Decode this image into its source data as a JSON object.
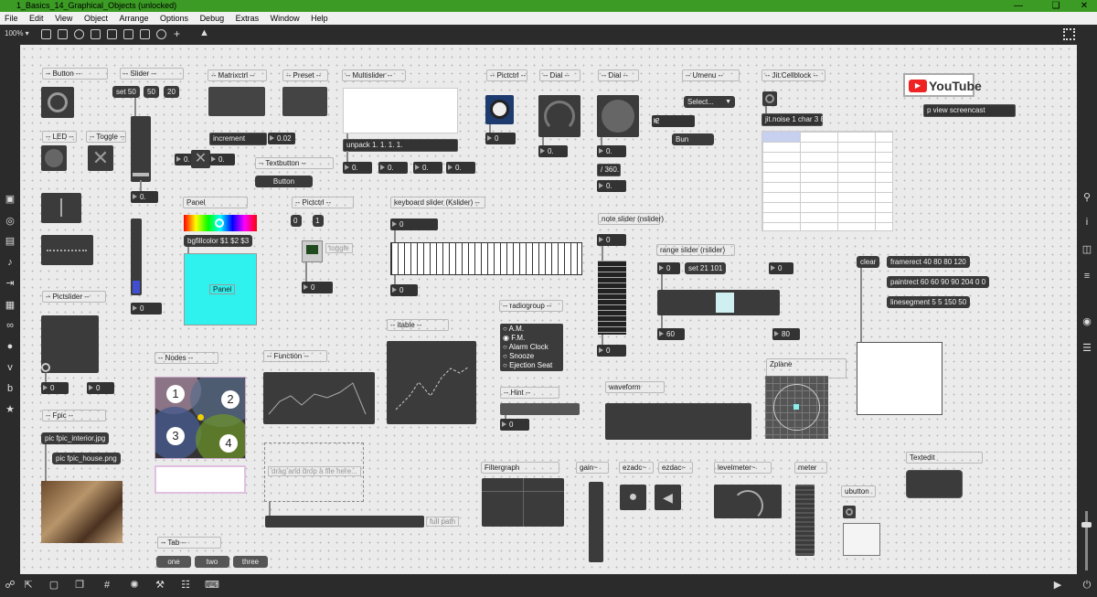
{
  "window": {
    "title": "1_Basics_14_Graphical_Objects (unlocked)"
  },
  "menu": [
    "File",
    "Edit",
    "View",
    "Object",
    "Arrange",
    "Options",
    "Debug",
    "Extras",
    "Window",
    "Help"
  ],
  "toolbar": {
    "zoom": "100% ▾"
  },
  "comments": {
    "button": "-- Button --",
    "slider": "-- Slider --",
    "matrixctrl": "-- Matrixctrl --",
    "preset": "-- Preset --",
    "multislider": "-- Multislider --",
    "pictctrl1": "-- Pictctrl --",
    "dial1": "-- Dial --",
    "dial2": "-- Dial --",
    "umenu": "-- Umenu --",
    "jitcellblock": "-- Jit.Cellblock --",
    "led": "-- LED --",
    "toggle": "-- Toggle --",
    "textbutton": "-- Textbutton --",
    "panel": "Panel",
    "pictctrl2": "-- Pictctrl --",
    "kslider": "keyboard slider (Kslider) --",
    "nslider": "note slider (nslider)",
    "rslider": "range slider (rslider)",
    "pictslider": "-- Pictslider --",
    "radiogroup": "-- radiogroup --",
    "itable": "-- itable --",
    "nodes": "-- Nodes --",
    "function": "-- Function --",
    "hint": "-- Hint --",
    "waveform": "waveform",
    "zplane": "Zplane",
    "fpic": "-- Fpic --",
    "filtergraph": "Filtergraph",
    "gain": "gain~",
    "ezadc": "ezadc~",
    "ezdac": "ezdac~",
    "levelmeter": "levelmeter~",
    "meter": "meter",
    "ubutton": "ubutton",
    "textedit": "Textedit",
    "tab": "-- Tab --",
    "toggle_label": "toggle",
    "fullpath": "full path"
  },
  "messages": {
    "set50": "set 50",
    "v50": "50",
    "v20": "20",
    "increment": "increment",
    "unpack": "unpack 1. 1. 1. 1.",
    "bgfillcolor": "bgfillcolor $1 $2 $3",
    "jitnoise": "jit.noise 1 char 3 8",
    "pview": "p view screencast",
    "clear": "clear",
    "framerect": "framerect 40 80 80 120",
    "paintrect": "paintrect 60 60 90 90 204 0 0",
    "linesegment": "linesegment 5 5 150 50",
    "set21101": "set 21 101",
    "m0": "0",
    "m1": "1",
    "pic_interior": "pic fpic_interior.jpg",
    "pic_house": "pic fpic_house.png",
    "drop": "drag and drop a file here...",
    "bun": "Bun",
    "two_num": "2",
    "select": "Select...",
    "panel_inner": "Panel",
    "textbutton_label": "Button"
  },
  "numbers": {
    "n0": "0.",
    "n002": "0.02",
    "n0i": "0",
    "n360": "/ 360.",
    "n60": "60",
    "n80": "80"
  },
  "radiogroup": [
    "A.M.",
    "F.M.",
    "Alarm Clock",
    "Snooze",
    "Ejection Seat"
  ],
  "nodes": [
    "1",
    "2",
    "3",
    "4"
  ],
  "tabs": [
    "one",
    "two",
    "three"
  ],
  "youtube": "YouTube",
  "colors": {
    "titlebar": "#3b9b24",
    "canvas": "#ebebeb",
    "panel": "#2ff2ee",
    "accent": "#f0d000"
  }
}
